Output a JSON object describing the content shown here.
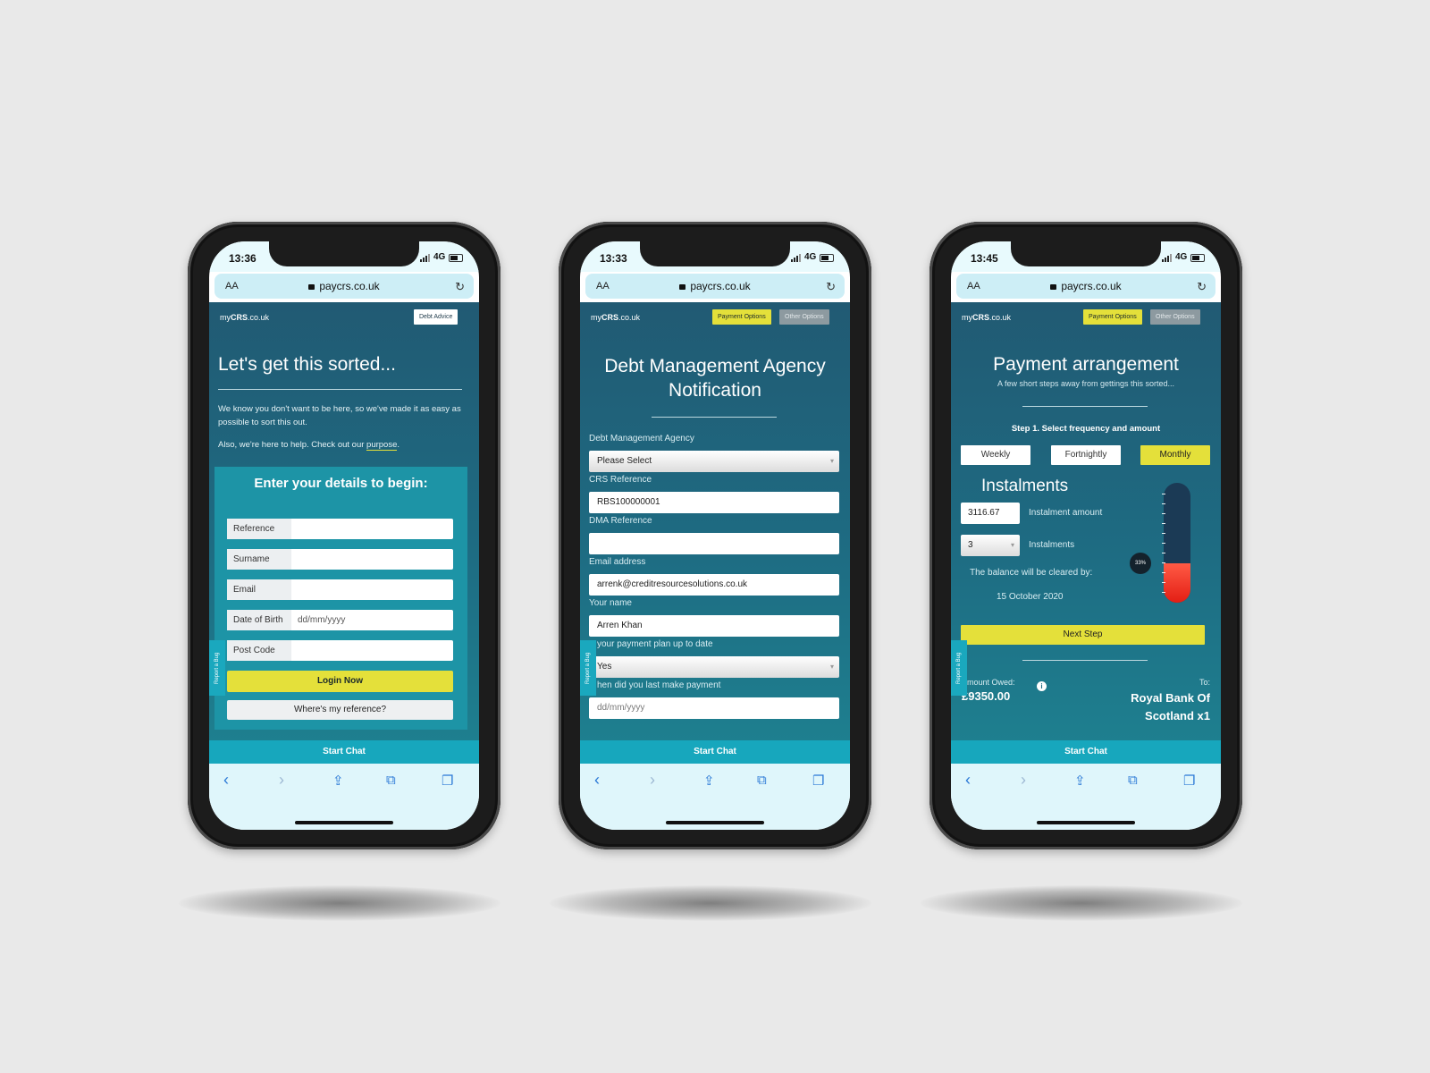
{
  "phones": [
    {
      "status": {
        "time": "13:36",
        "network": "4G"
      },
      "browser": {
        "text_size": "AA",
        "url": "paycrs.co.uk"
      },
      "header": {
        "logo_prefix": "my",
        "logo_bold": "CRS",
        "logo_suffix": ".co.uk",
        "button": "Debt Advice"
      },
      "title": "Let's get this sorted...",
      "intro": "We know you don't want to be here, so we've made it as easy as possible to sort this out.",
      "help_text": "Also, we're here to help. Check out our",
      "help_link": "purpose",
      "help_end": ".",
      "form": {
        "heading": "Enter your details to begin:",
        "fields": [
          {
            "label": "Reference",
            "value": ""
          },
          {
            "label": "Surname",
            "value": ""
          },
          {
            "label": "Email",
            "value": ""
          },
          {
            "label": "Date of Birth",
            "placeholder": "dd/mm/yyyy"
          },
          {
            "label": "Post Code",
            "value": ""
          }
        ],
        "login_button": "Login Now",
        "reference_button": "Where's my reference?"
      },
      "report_tab": "Report a Bug",
      "chat": "Start Chat"
    },
    {
      "status": {
        "time": "13:33",
        "network": "4G"
      },
      "browser": {
        "text_size": "AA",
        "url": "paycrs.co.uk"
      },
      "header": {
        "logo_prefix": "my",
        "logo_bold": "CRS",
        "logo_suffix": ".co.uk",
        "button_primary": "Payment Options",
        "button_secondary": "Other Options"
      },
      "title_line1": "Debt Management Agency",
      "title_line2": "Notification",
      "fields": [
        {
          "label": "Debt Management Agency",
          "value": "Please Select",
          "type": "select"
        },
        {
          "label": "CRS Reference",
          "value": "RBS100000001"
        },
        {
          "label": "DMA Reference",
          "value": ""
        },
        {
          "label": "Email address",
          "value": "arrenk@creditresourcesolutions.co.uk"
        },
        {
          "label": "Your name",
          "value": "Arren Khan"
        },
        {
          "label": "your payment plan up to date",
          "value": "Yes",
          "type": "select"
        },
        {
          "label": "hen did you last make payment",
          "value": "dd/mm/yyyy"
        }
      ],
      "report_tab": "Report a Bug",
      "chat": "Start Chat"
    },
    {
      "status": {
        "time": "13:45",
        "network": "4G"
      },
      "browser": {
        "text_size": "AA",
        "url": "paycrs.co.uk"
      },
      "header": {
        "logo_prefix": "my",
        "logo_bold": "CRS",
        "logo_suffix": ".co.uk",
        "button_primary": "Payment Options",
        "button_secondary": "Other Options"
      },
      "title": "Payment arrangement",
      "subtitle": "A few short steps away from gettings this sorted...",
      "step": "Step 1. Select frequency and amount",
      "frequencies": [
        "Weekly",
        "Fortnightly",
        "Monthly"
      ],
      "selected_frequency": "Monthly",
      "instalments_heading": "Instalments",
      "amount": "3116.67",
      "amount_label": "Instalment amount",
      "count": "3",
      "count_label": "Instalments",
      "cleared_label": "The balance will be cleared by:",
      "cleared_date": "15 October 2020",
      "progress_label": "33%",
      "progress_fraction": 0.33,
      "next_button": "Next Step",
      "owed_label": "mount Owed:",
      "owed_value": "£9350.00",
      "to_label": "To:",
      "to_line1": "Royal Bank Of",
      "to_line2": "Scotland x1",
      "report_tab": "Report a Bug",
      "chat": "Start Chat"
    }
  ]
}
